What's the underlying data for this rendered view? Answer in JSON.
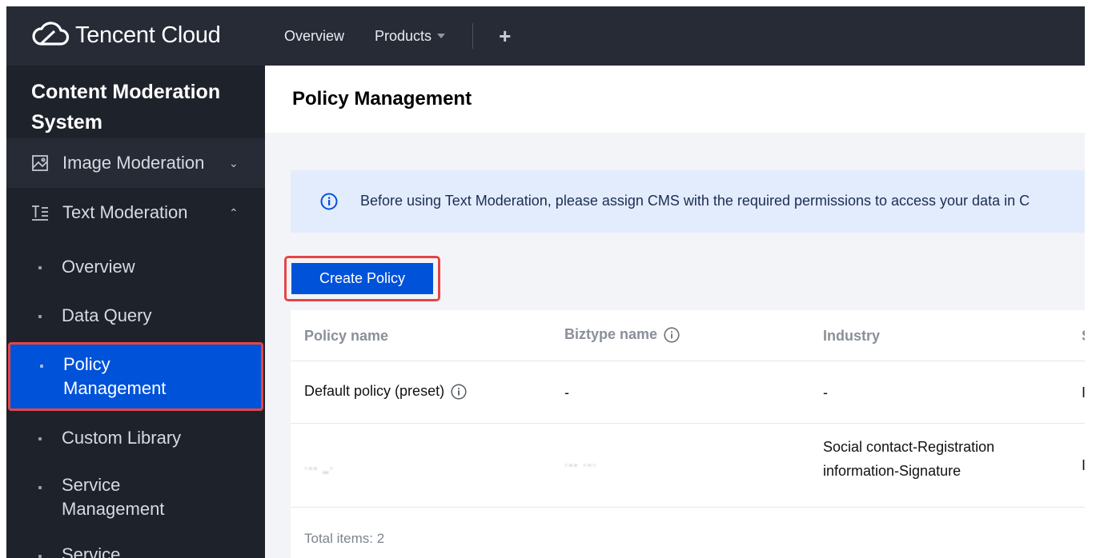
{
  "brand": {
    "name": "Tencent Cloud",
    "logo_icon": "tencent-cloud-logo-icon"
  },
  "topnav": {
    "overview": "Overview",
    "products": "Products",
    "add": "+"
  },
  "sidebar": {
    "title": "Content Moderation System",
    "image_moderation": "Image Moderation",
    "text_moderation": "Text Moderation",
    "items": [
      "Overview",
      "Data Query",
      "Policy Management",
      "Custom Library",
      "Service Management",
      "Service"
    ],
    "active_item": "Policy Management"
  },
  "page": {
    "title": "Policy Management"
  },
  "notice": {
    "text": "Before using Text Moderation, please assign CMS with the required permissions to access your data in C"
  },
  "toolbar": {
    "create_label": "Create Policy"
  },
  "table": {
    "headers": [
      "Policy name",
      "Biztype name",
      "Industry",
      "S"
    ],
    "rows": [
      {
        "policy_name": "Default policy (preset)",
        "biztype": "-",
        "industry": "-",
        "status_cut": "I"
      },
      {
        "policy_name": "·-- _·",
        "biztype": "·-- ·-·",
        "industry_line1": "Social contact-Registration",
        "industry_line2": "information-Signature",
        "status_cut": "I"
      }
    ],
    "total": "Total items:  2"
  },
  "colors": {
    "accent": "#0052d9",
    "highlight": "#e54545",
    "topbar": "#262b36",
    "sidebar": "#1e222b"
  }
}
